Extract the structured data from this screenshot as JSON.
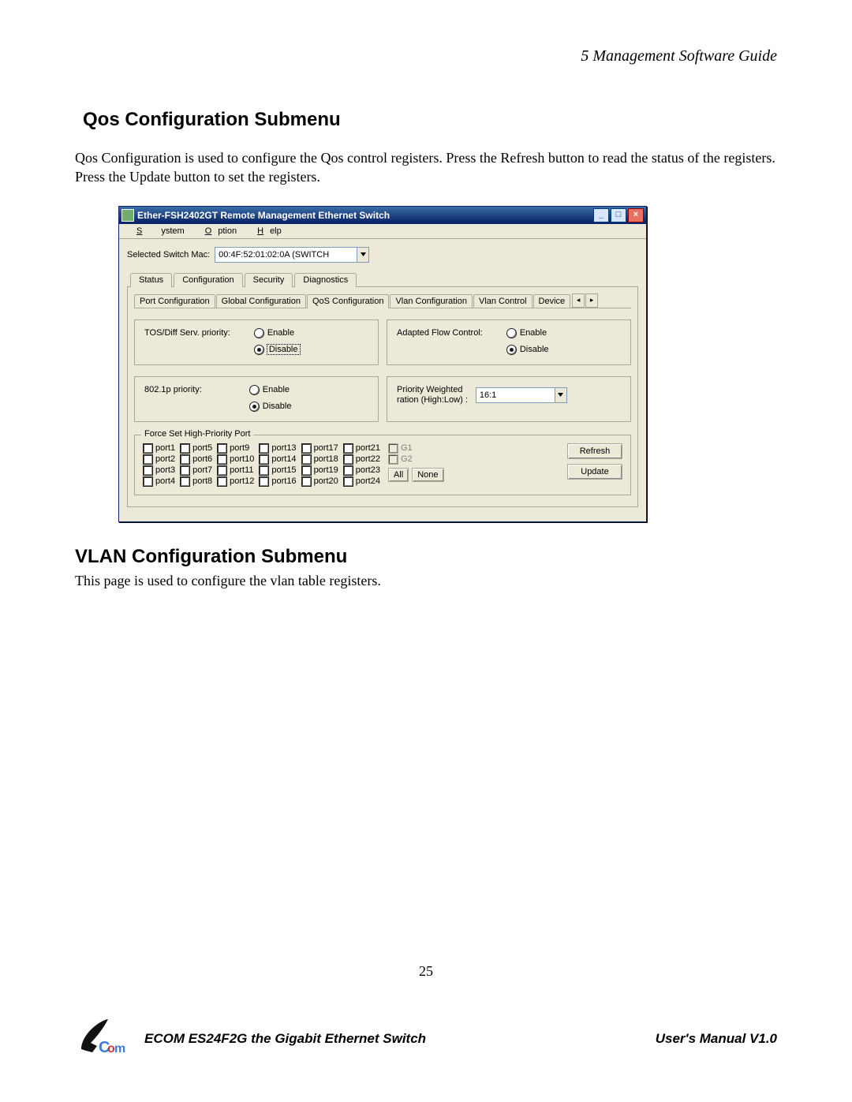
{
  "doc": {
    "chapter_line": "5   Management Software Guide",
    "section1_title": "Qos Configuration Submenu",
    "section1_body": "Qos Configuration is used to configure the Qos control registers. Press the Refresh button to read the status of the registers. Press the Update button to set the registers.",
    "section2_title": "VLAN Configuration Submenu",
    "section2_body": "This page is used to configure the vlan table registers.",
    "page_number": "25",
    "footer_left": "ECOM ES24F2G the Gigabit Ethernet Switch",
    "footer_right": "User's Manual V1.0",
    "logo_text": "Com"
  },
  "win": {
    "title": "Ether-FSH2402GT Remote Management Ethernet Switch",
    "menus": {
      "m1": "System",
      "m2": "Option",
      "m3": "Help"
    },
    "sel_label": "Selected Switch Mac:",
    "sel_value": "00:4F:52:01:02:0A (SWITCH",
    "tabs": {
      "t1": "Status",
      "t2": "Configuration",
      "t3": "Security",
      "t4": "Diagnostics"
    },
    "subtabs": {
      "s1": "Port Configuration",
      "s2": "Global Configuration",
      "s3": "QoS Configuration",
      "s4": "Vlan Configuration",
      "s5": "Vlan Control",
      "s6": "Device"
    },
    "tos_label": "TOS/Diff Serv. priority:",
    "p8021_label": "802.1p priority:",
    "afc_label": "Adapted Flow Control:",
    "pw_label1": "Priority Weighted",
    "pw_label2": "ration (High:Low) :",
    "pw_value": "16:1",
    "enable": "Enable",
    "disable": "Disable",
    "fieldset_legend": "Force Set High-Priority Port",
    "ports": {
      "p1": "port1",
      "p2": "port2",
      "p3": "port3",
      "p4": "port4",
      "p5": "port5",
      "p6": "port6",
      "p7": "port7",
      "p8": "port8",
      "p9": "port9",
      "p10": "port10",
      "p11": "port11",
      "p12": "port12",
      "p13": "port13",
      "p14": "port14",
      "p15": "port15",
      "p16": "port16",
      "p17": "port17",
      "p18": "port18",
      "p19": "port19",
      "p20": "port20",
      "p21": "port21",
      "p22": "port22",
      "p23": "port23",
      "p24": "port24",
      "g1": "G1",
      "g2": "G2"
    },
    "btn_all": "All",
    "btn_none": "None",
    "btn_refresh": "Refresh",
    "btn_update": "Update"
  }
}
